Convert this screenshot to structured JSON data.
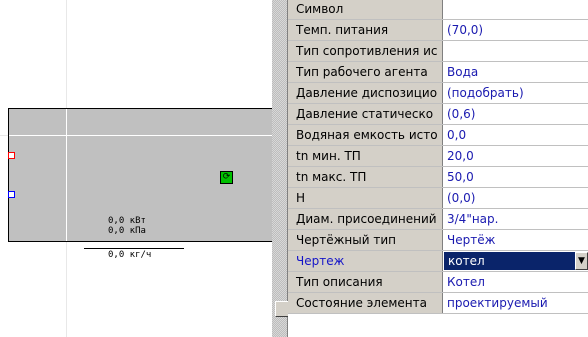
{
  "canvas": {
    "power_label": "0,0 кВт",
    "pressure_label": "0,0 кПа",
    "flow_label": "0,0 кг/ч"
  },
  "properties": [
    {
      "name": "Символ",
      "value": ""
    },
    {
      "name": "Темп. питания",
      "value": "(70,0)"
    },
    {
      "name": "Тип сопротивления ис",
      "value": ""
    },
    {
      "name": "Тип рабочего агента",
      "value": "Вода"
    },
    {
      "name": "Давление диспозицио",
      "value": "(подобрать)"
    },
    {
      "name": "Давление статическо",
      "value": "(0,6)"
    },
    {
      "name": "Водяная емкость исто",
      "value": "0,0"
    },
    {
      "name": "tn мин. ТП",
      "value": "20,0"
    },
    {
      "name": "tn макс. ТП",
      "value": "50,0"
    },
    {
      "name": "H",
      "value": "(0,0)"
    },
    {
      "name": "Диам. присоединений",
      "value": "3/4\"нар."
    },
    {
      "name": "Чертёжный тип",
      "value": "Чертёж"
    },
    {
      "name": "Чертеж",
      "value": "котел"
    },
    {
      "name": "Тип описания",
      "value": "Котел"
    },
    {
      "name": "Состояние элемента",
      "value": "проектируемый"
    }
  ],
  "selected_index": 12,
  "colors": {
    "value_text": "#1a1ab0",
    "selection_bg": "#0a246a",
    "element_fill": "#c0c0c0"
  }
}
